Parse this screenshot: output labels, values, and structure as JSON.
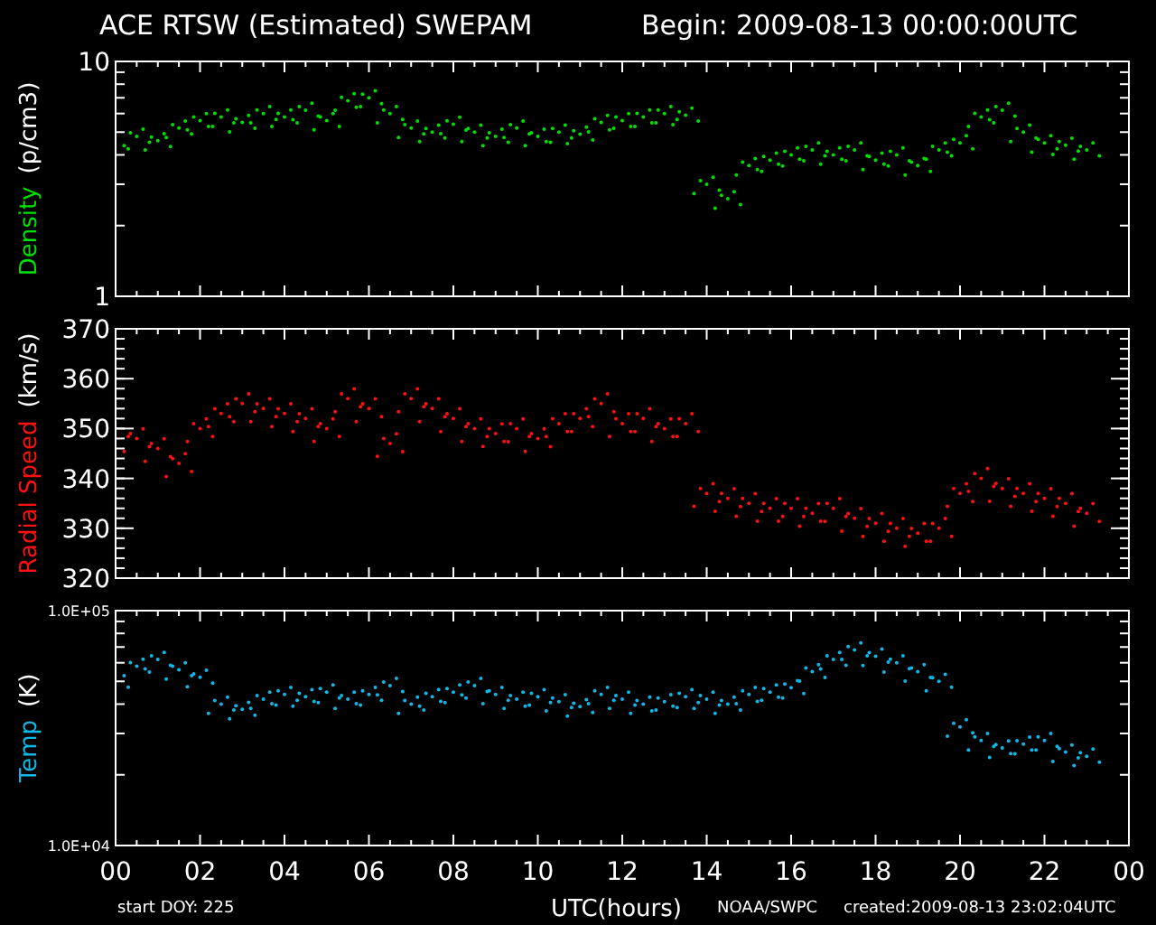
{
  "title": "ACE RTSW (Estimated) SWEPAM",
  "begin": "Begin: 2009-08-13 00:00:00UTC",
  "panels": [
    {
      "kind": "log",
      "quantity": "Density",
      "unit": "(p/cm3)",
      "color": "#00e000",
      "ytick_labels": [
        "10",
        "1"
      ]
    },
    {
      "kind": "linear",
      "quantity": "Radial Speed",
      "unit": "(km/s)",
      "color": "#ff1010",
      "ytick_labels": [
        "370",
        "360",
        "350",
        "340",
        "330",
        "320"
      ]
    },
    {
      "kind": "log",
      "quantity": "Temp",
      "unit": "(K)",
      "color": "#10b8e8",
      "ytick_labels": [
        "1.0E+05",
        "1.0E+04"
      ]
    }
  ],
  "xtick_labels": [
    "00",
    "02",
    "04",
    "06",
    "08",
    "10",
    "12",
    "14",
    "16",
    "18",
    "20",
    "22",
    "00"
  ],
  "footer": {
    "start": "start DOY: 225",
    "xlabel": "UTC(hours)",
    "source": "NOAA/SWPC",
    "created": "created:2009-08-13 23:02:04UTC"
  }
}
